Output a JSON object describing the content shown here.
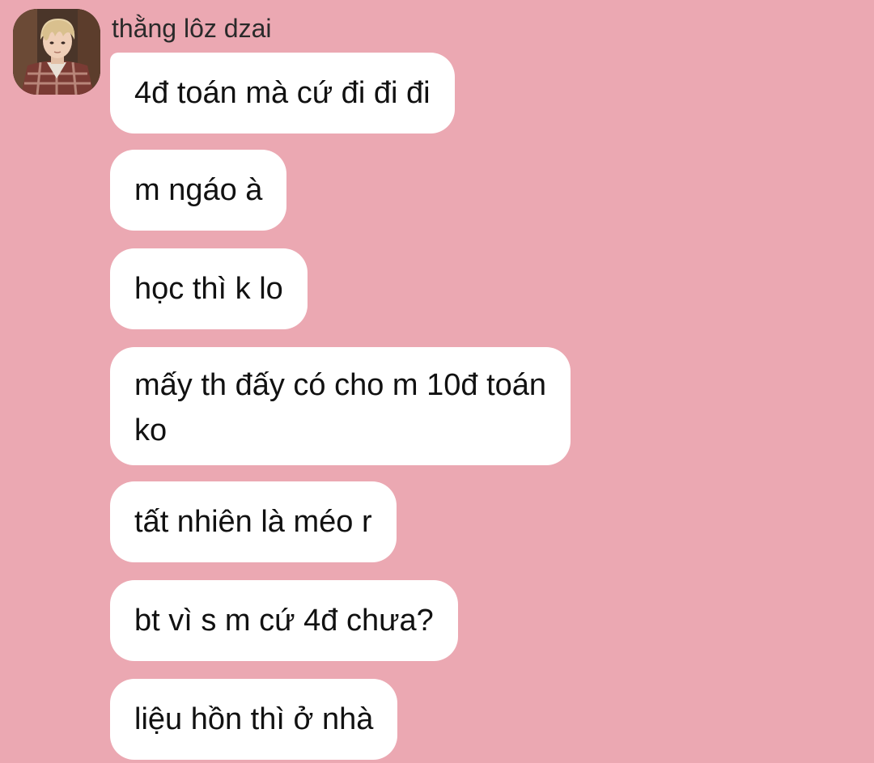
{
  "chat": {
    "sender_name": "thằng lôz dzai",
    "avatar_icon": "user-avatar-photo",
    "background_color": "#eba8b2",
    "bubble_color": "#ffffff"
  },
  "messages": [
    {
      "lines": [
        "4đ toán mà cứ đi đi đi"
      ]
    },
    {
      "lines": [
        "m ngáo à"
      ]
    },
    {
      "lines": [
        "học thì k lo"
      ]
    },
    {
      "lines": [
        "mấy th đấy có cho m 10đ toán",
        "ko"
      ]
    },
    {
      "lines": [
        "tất nhiên là méo r"
      ]
    },
    {
      "lines": [
        "bt vì s m cứ 4đ chưa?"
      ]
    },
    {
      "lines": [
        "liệu hồn thì ở nhà"
      ]
    }
  ]
}
